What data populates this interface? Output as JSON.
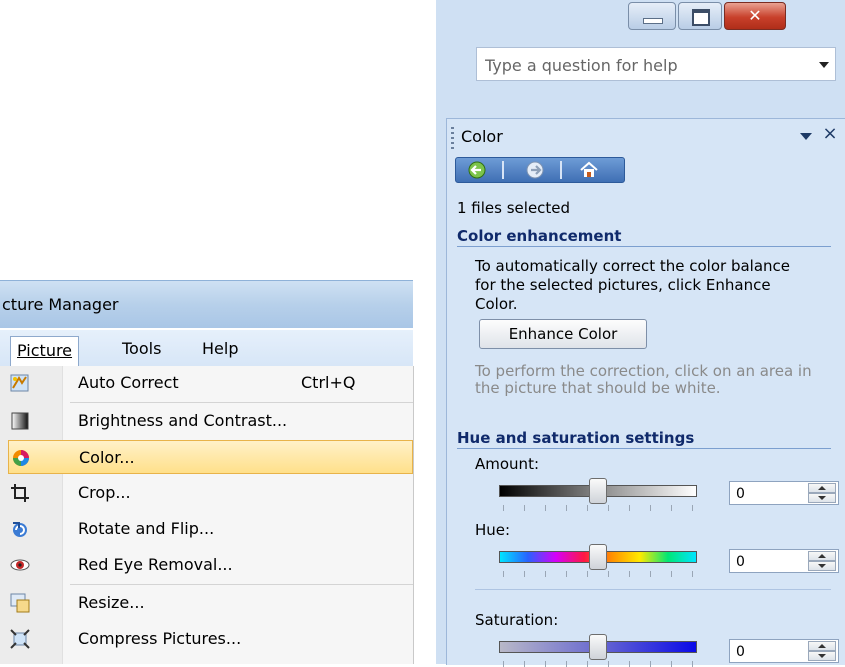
{
  "picture_manager": {
    "title": "cture Manager",
    "menubar": {
      "picture": "Picture",
      "tools": "Tools",
      "help": "Help"
    },
    "items": [
      {
        "label": "Auto Correct",
        "shortcut": "Ctrl+Q",
        "icon": "auto-correct-icon"
      },
      {
        "label": "Brightness and Contrast...",
        "icon": "brightness-contrast-icon"
      },
      {
        "label": "Color...",
        "icon": "color-wheel-icon",
        "highlighted": true
      },
      {
        "label": "Crop...",
        "icon": "crop-icon"
      },
      {
        "label": "Rotate and Flip...",
        "icon": "rotate-flip-icon"
      },
      {
        "label": "Red Eye Removal...",
        "icon": "red-eye-icon"
      },
      {
        "label": "Resize...",
        "icon": "resize-icon"
      },
      {
        "label": "Compress Pictures...",
        "icon": "compress-icon"
      }
    ]
  },
  "window": {
    "help_placeholder": "Type a question for help"
  },
  "task_pane": {
    "title": "Color",
    "files_selected": "1 files selected",
    "color_enhancement": {
      "heading": "Color enhancement",
      "description": "To automatically correct the color balance for the selected pictures, click Enhance Color.",
      "button": "Enhance Color",
      "hint": "To perform the correction, click on an area in the picture that should be white."
    },
    "hue_saturation": {
      "heading": "Hue and saturation settings",
      "amount": {
        "label": "Amount:",
        "value": "0",
        "slider_fraction": 0.5
      },
      "hue": {
        "label": "Hue:",
        "value": "0",
        "slider_fraction": 0.5
      },
      "saturation": {
        "label": "Saturation:",
        "value": "0",
        "slider_fraction": 0.5
      }
    }
  },
  "colors": {
    "highlight": "#ffe08a",
    "pane_bg": "#d6e5f6",
    "heading": "#102a6b"
  }
}
